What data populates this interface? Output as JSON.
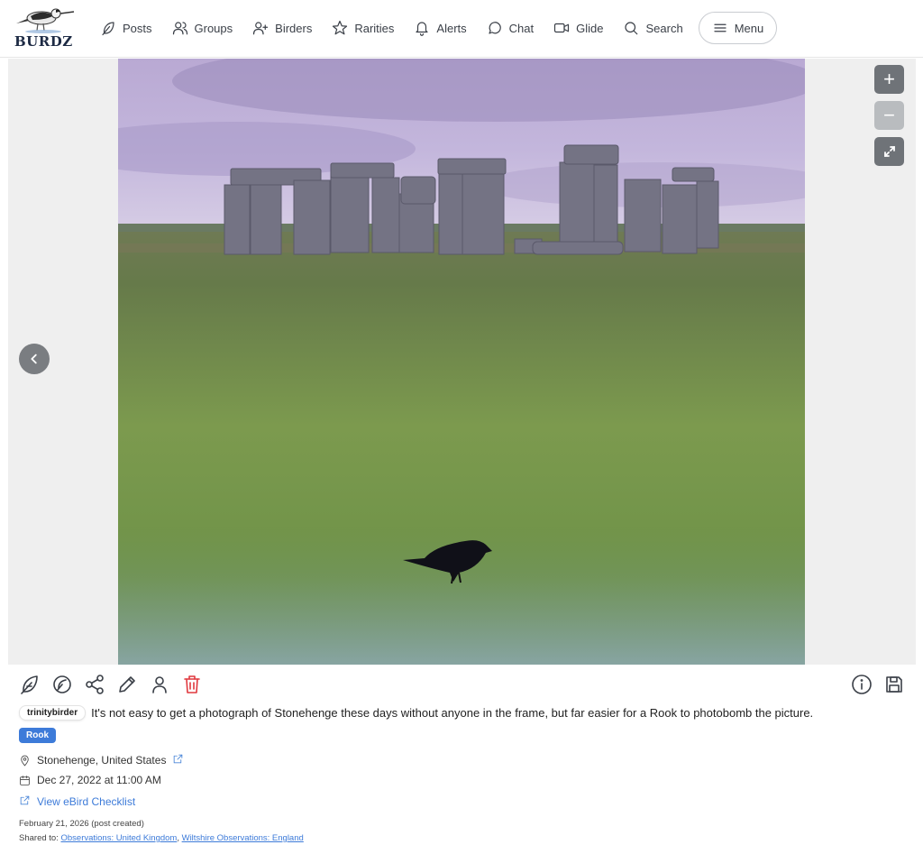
{
  "app": {
    "logo_text": "BURDZ"
  },
  "nav": {
    "items": [
      {
        "label": "Posts",
        "icon": "feather-icon"
      },
      {
        "label": "Groups",
        "icon": "users-icon"
      },
      {
        "label": "Birders",
        "icon": "user-plus-icon"
      },
      {
        "label": "Rarities",
        "icon": "star-icon"
      },
      {
        "label": "Alerts",
        "icon": "bell-icon"
      },
      {
        "label": "Chat",
        "icon": "chat-bubble-icon"
      },
      {
        "label": "Glide",
        "icon": "video-icon"
      },
      {
        "label": "Search",
        "icon": "search-icon"
      }
    ],
    "menu_label": "Menu"
  },
  "viewer": {
    "zoom_in_label": "+",
    "zoom_out_label": "−"
  },
  "post": {
    "username": "trinitybirder",
    "caption": "It's not easy to get a photograph of Stonehenge these days without anyone in the frame, but far easier for a Rook to photobomb the picture.",
    "species": "Rook",
    "location": "Stonehenge, United States",
    "datetime": "Dec 27, 2022 at 11:00 AM",
    "ebird_link": "View eBird Checklist",
    "created": "February 21, 2026 (post created)",
    "shared_prefix": "Shared to:",
    "shared_groups": [
      "Observations: United Kingdom",
      "Wiltshire Observations: England"
    ],
    "shared_separator": ","
  },
  "colors": {
    "accent": "#3d7bd9",
    "danger": "#e0383e",
    "viewer_bg": "#efefef",
    "control": "#6f7378"
  }
}
